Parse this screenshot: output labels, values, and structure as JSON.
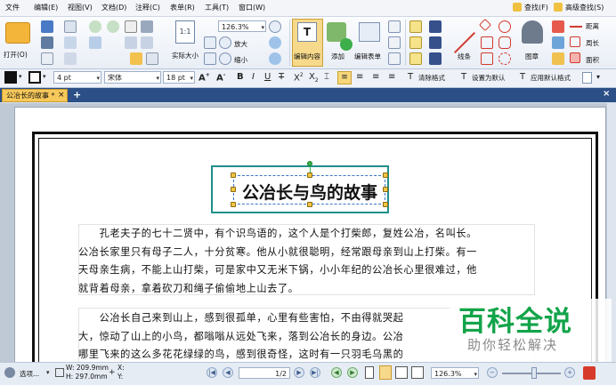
{
  "menu": {
    "items": [
      "文件",
      "编辑(E)",
      "视图(V)",
      "文档(D)",
      "注释(C)",
      "表单(R)",
      "工具(T)",
      "窗口(W)"
    ],
    "find_label": "查找(F)",
    "advanced_find_label": "高级查找(S)"
  },
  "ribbon": {
    "open_label": "打开(O)",
    "actual_size_label": "实际大小",
    "zoom_value": "126.3%",
    "zoom_in_label": "放大",
    "zoom_out_label": "缩小",
    "edit_content_label": "编辑内容",
    "add_label": "添加",
    "edit_form_label": "编辑表单",
    "line_label": "线条",
    "stamp_label": "图章",
    "distance_label": "距离",
    "perimeter_label": "周长",
    "area_label": "面积"
  },
  "format_bar": {
    "line_width": "4 pt",
    "font_name": "宋体",
    "font_size": "18 pt",
    "clear_format_label": "清除格式",
    "set_default_label": "设置为默认",
    "apply_default_label": "应用默认格式",
    "accent": "#2b4f86"
  },
  "tab": {
    "label": "公冶长的故事 *"
  },
  "document": {
    "title": "公冶长与鸟的故事",
    "paragraph1": [
      "　　孔老夫子的七十二贤中，有个识鸟语的，这个人是个打柴郎，复姓公冶，名叫长。",
      "公冶长家里只有母子二人，十分贫寒。他从小就很聪明，经常跟母亲到山上打柴。有一",
      "天母亲生病，不能上山打柴，可是家中又无米下锅，小小年纪的公冶长心里很难过，他",
      "就背着母亲，拿着砍刀和绳子偷偷地上山去了。"
    ],
    "paragraph2": [
      "　　公冶长自己来到山上，感到很孤单，心里有些害怕，不由得就哭起",
      "大，惊动了山上的小鸟，都嗡嗡从远处飞来，落到公冶长的身边。公冶",
      "哪里飞来的这么多花花绿绿的鸟，感到很奇怪，这时有一只羽毛乌黑的"
    ]
  },
  "status": {
    "select_label": "选项...",
    "width": "W: 209.9mm",
    "height": "H: 297.0mm",
    "x_label": "X:",
    "y_label": "Y:",
    "page": "1/2",
    "zoom": "126.3%"
  },
  "watermark": {
    "main": "百科全说",
    "sub": "助你轻松解决",
    "color": "#12a44a"
  }
}
